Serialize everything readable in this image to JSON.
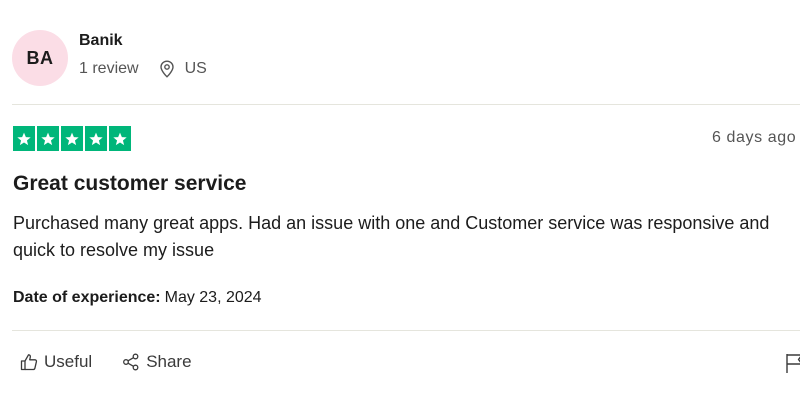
{
  "reviewer": {
    "initials": "BA",
    "name": "Banik",
    "review_count": "1 review",
    "location": "US"
  },
  "review": {
    "rating": 5,
    "rating_max": 5,
    "date_posted": "6 days ago",
    "title": "Great customer service",
    "body": "Purchased many great apps. Had an issue with one and Customer service was responsive and quick to resolve my issue",
    "experience_label": "Date of experience:",
    "experience_date": "May 23, 2024"
  },
  "actions": {
    "useful_label": "Useful",
    "share_label": "Share"
  },
  "colors": {
    "star_green": "#00b67a",
    "avatar_bg": "#fbdde6"
  },
  "icons": [
    "location-pin-icon",
    "star-icon",
    "thumbs-up-icon",
    "share-icon",
    "flag-icon"
  ]
}
